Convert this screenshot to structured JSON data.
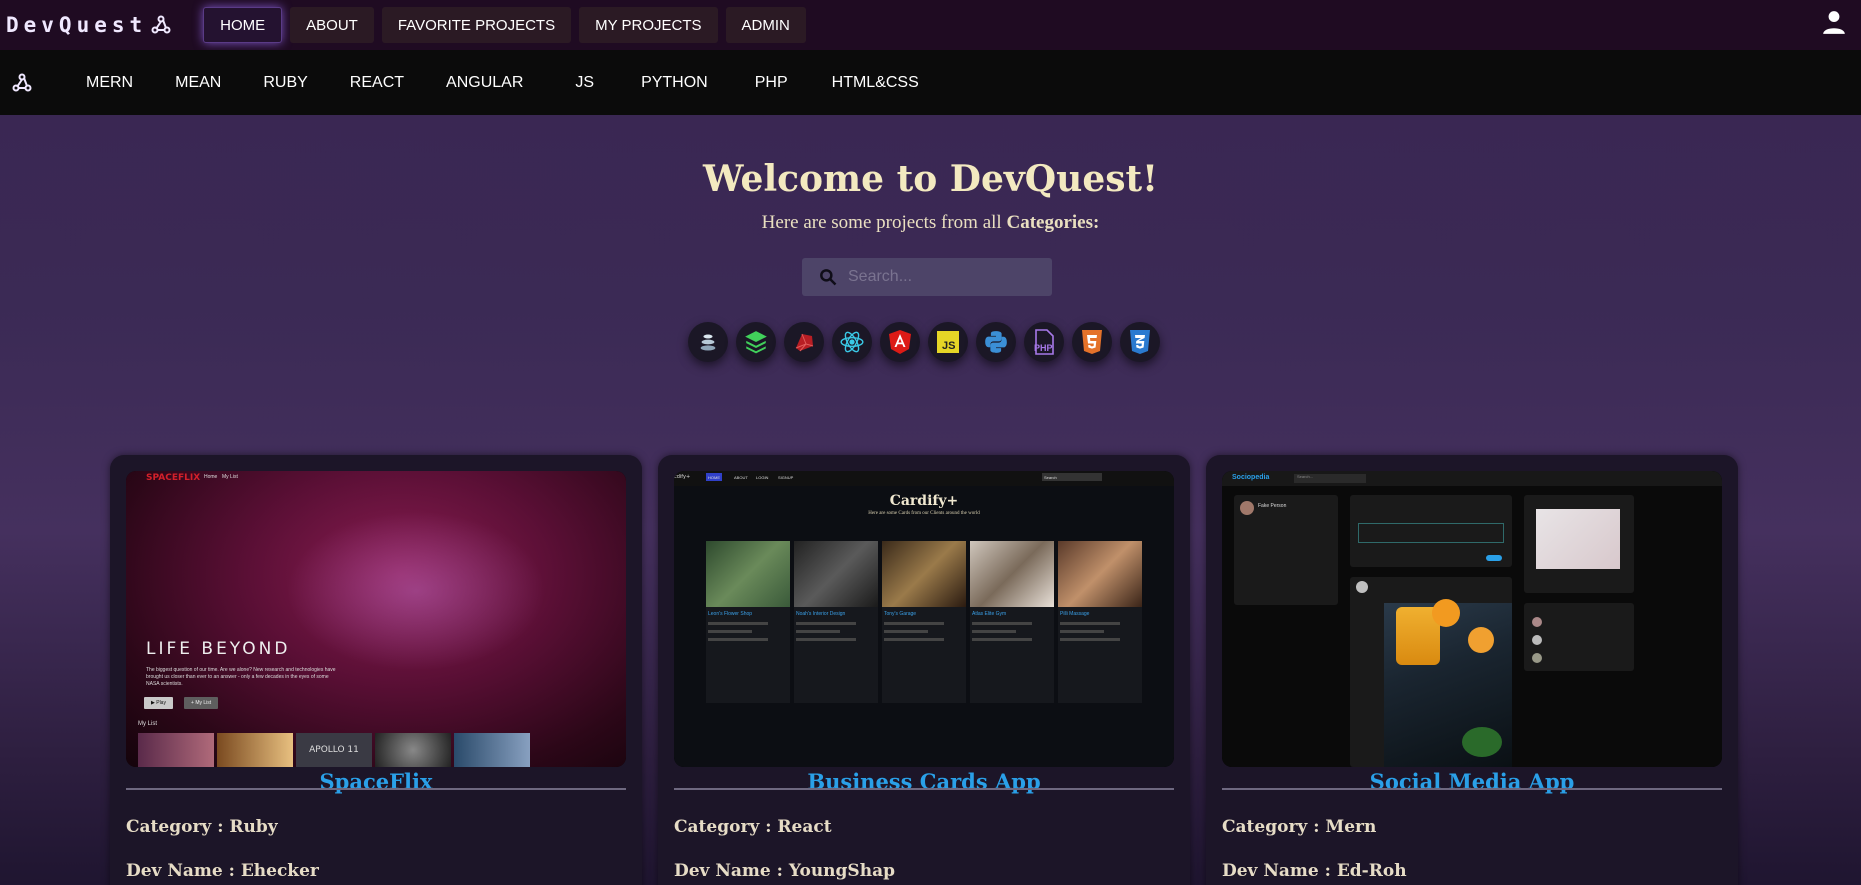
{
  "brand": {
    "name": "DevQuest"
  },
  "topnav": {
    "items": [
      "HOME",
      "ABOUT",
      "FAVORITE PROJECTS",
      "MY PROJECTS",
      "ADMIN"
    ],
    "active": "HOME"
  },
  "categories": [
    "MERN",
    "MEAN",
    "RUBY",
    "REACT",
    "ANGULAR",
    "JS",
    "PYTHON",
    "PHP",
    "HTML&CSS"
  ],
  "hero": {
    "title": "Welcome to DevQuest!",
    "subtitle_prefix": "Here are some projects from all",
    "subtitle_bold": "Categories:"
  },
  "search": {
    "placeholder": "Search..."
  },
  "tech_icons": [
    "stack-icon",
    "layers-icon",
    "ruby-icon",
    "react-icon",
    "angular-icon",
    "js-icon",
    "python-icon",
    "php-icon",
    "html5-icon",
    "css3-icon"
  ],
  "projects": [
    {
      "title": "SpaceFlix",
      "category_label": "Category : Ruby",
      "dev_label": "Dev Name : Ehecker",
      "preview": {
        "logo": "SPACEFLIX",
        "nav": [
          "Home",
          "My List"
        ],
        "headline": "LIFE BEYOND",
        "description": "The biggest question of our time. Are we alone? New research and technologies have brought us closer than ever to an answer - only a few decades in the eyes of some NASA scientists.",
        "play": "Play",
        "mylist_btn": "My List",
        "row_title": "My List",
        "thumb_text": "APOLLO 11"
      }
    },
    {
      "title": "Business Cards App",
      "category_label": "Category : React",
      "dev_label": "Dev Name : YoungShap",
      "preview": {
        "logo": "cdify+",
        "nav": [
          "HOME",
          "ABOUT",
          "LOGIN",
          "SIGNUP"
        ],
        "search": "Search",
        "headline": "Cardify+",
        "subtitle": "Here are some Cards from our Clients around the world",
        "cards": [
          "Leon's Flower Shop",
          "Noah's Interior Design",
          "Tony's Garage",
          "Atlas Elite Gym",
          "Pilli Massage"
        ]
      }
    },
    {
      "title": "Social Media App",
      "category_label": "Category : Mern",
      "dev_label": "Dev Name : Ed-Roh",
      "preview": {
        "logo": "Sociopedia",
        "search": "Search...",
        "user": "Fake Person"
      }
    }
  ],
  "colors": {
    "accent_blue": "#2aa0e8",
    "title_cream": "#f3e9c0",
    "topbar": "#1f0b22",
    "catbar": "#0b0b0b"
  }
}
